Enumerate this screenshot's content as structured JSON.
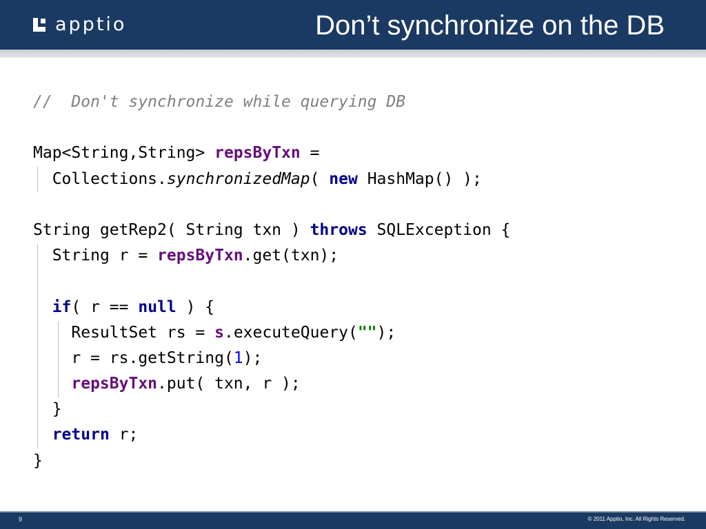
{
  "header": {
    "logo_text": "apptio",
    "title": "Don’t synchronize on the DB"
  },
  "code": {
    "comment": "//  Don't synchronize while querying DB",
    "map_decl": "Map<String,String> ",
    "map_field": "repsByTxn",
    "map_eq": " =",
    "coll": "Collections.",
    "coll_method": "synchronizedMap",
    "coll_paren": "( ",
    "new_kw": "new",
    "coll_rest": " HashMap() );",
    "method_sig": "String getRep2( String txn ) ",
    "throws_kw": "throws",
    "method_rest": " SQLException {",
    "get_pre": "String r = ",
    "get_field": "repsByTxn",
    "get_post": ".get(txn);",
    "if_kw": "if",
    "if_mid": "( r == ",
    "null_kw": "null",
    "if_end": " ) {",
    "rs_pre": "ResultSet rs = ",
    "rs_field": "s",
    "rs_mid": ".executeQuery(",
    "rs_str": "\"\"",
    "rs_end": ");",
    "r_pre": "r = rs.getString(",
    "r_num": "1",
    "r_end": ");",
    "put_field": "repsByTxn",
    "put_rest": ".put( txn, r );",
    "close_inner": "}",
    "return_kw": "return",
    "return_rest": " r;",
    "close_outer": "}"
  },
  "footer": {
    "page_number": "9",
    "copyright": "© 2011 Apptio, Inc. All Rights Reserved."
  }
}
